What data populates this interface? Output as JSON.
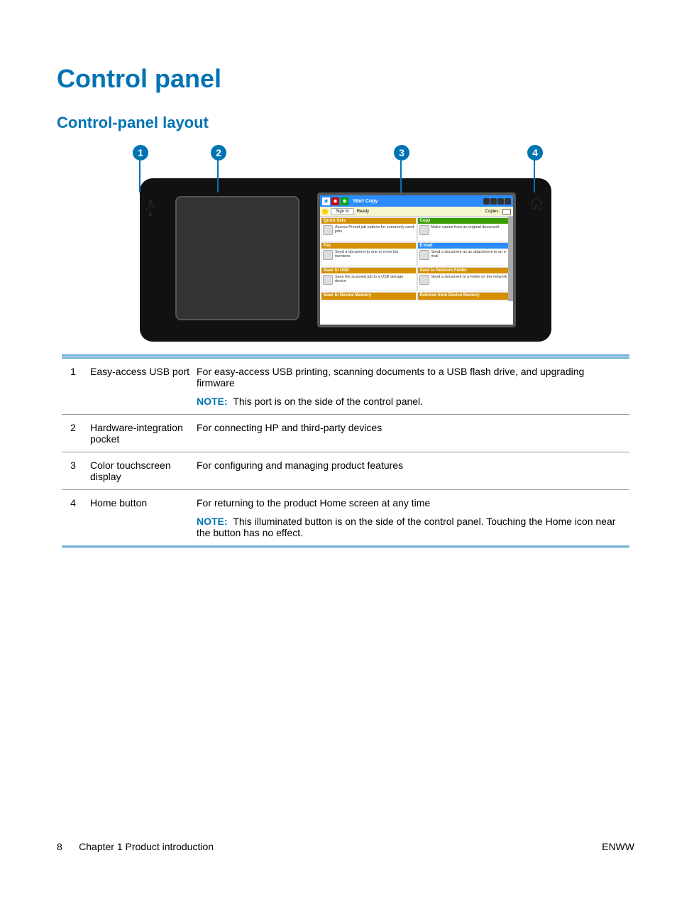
{
  "heading": "Control panel",
  "subheading": "Control-panel layout",
  "callouts": {
    "c1": "1",
    "c2": "2",
    "c3": "3",
    "c4": "4"
  },
  "screen": {
    "header_title": "Start Copy",
    "signin_btn": "Sign In",
    "status": "Ready",
    "copies_label": "Copies:",
    "tiles": {
      "quicksets": {
        "title": "Quick Sets",
        "desc": "Access Preset job options for commonly used jobs"
      },
      "copy": {
        "title": "Copy",
        "desc": "Make copies from an original document"
      },
      "fax": {
        "title": "Fax",
        "desc": "Send a document to one or more fax numbers"
      },
      "email": {
        "title": "E-mail",
        "desc": "Send a document as an attachment to an e-mail"
      },
      "saveusb": {
        "title": "Save to USB",
        "desc": "Save the scanned job to a USB storage device"
      },
      "savenet": {
        "title": "Save to Network Folder",
        "desc": "Send a document to a folder on the network"
      },
      "savemem": {
        "title": "Save to Device Memory"
      },
      "retmem": {
        "title": "Retrieve from Device Memory"
      }
    }
  },
  "table": [
    {
      "num": "1",
      "name": "Easy-access USB port",
      "desc": "For easy-access USB printing, scanning documents to a USB flash drive, and upgrading firmware",
      "note": "This port is on the side of the control panel."
    },
    {
      "num": "2",
      "name": "Hardware-integration pocket",
      "desc": "For connecting HP and third-party devices"
    },
    {
      "num": "3",
      "name": "Color touchscreen display",
      "desc": "For configuring and managing product features"
    },
    {
      "num": "4",
      "name": "Home button",
      "desc": "For returning to the product Home screen at any time",
      "note": "This illuminated button is on the side of the control panel. Touching the Home icon near the button has no effect."
    }
  ],
  "note_label": "NOTE:",
  "footer": {
    "page": "8",
    "chapter": "Chapter 1   Product introduction",
    "lang": "ENWW"
  }
}
